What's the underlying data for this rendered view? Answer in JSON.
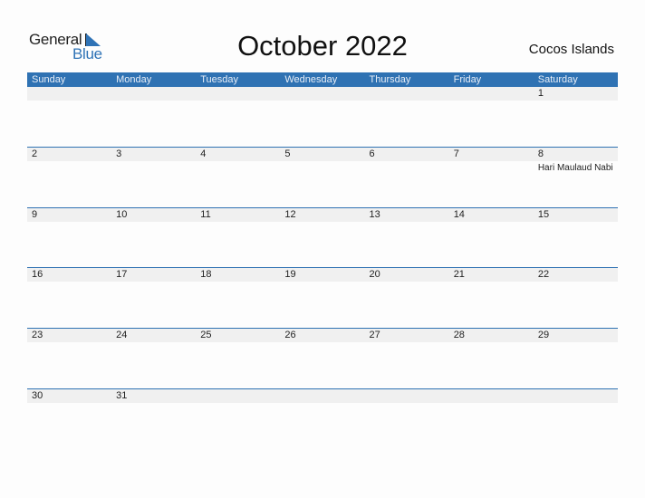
{
  "logo": {
    "line1": "General",
    "line2": "Blue"
  },
  "title": "October 2022",
  "country": "Cocos Islands",
  "colors": {
    "accent": "#2f72b3",
    "band": "#f0f0f0"
  },
  "weekdays": [
    "Sunday",
    "Monday",
    "Tuesday",
    "Wednesday",
    "Thursday",
    "Friday",
    "Saturday"
  ],
  "weeks": [
    [
      {
        "day": ""
      },
      {
        "day": ""
      },
      {
        "day": ""
      },
      {
        "day": ""
      },
      {
        "day": ""
      },
      {
        "day": ""
      },
      {
        "day": "1"
      }
    ],
    [
      {
        "day": "2"
      },
      {
        "day": "3"
      },
      {
        "day": "4"
      },
      {
        "day": "5"
      },
      {
        "day": "6"
      },
      {
        "day": "7"
      },
      {
        "day": "8",
        "event": "Hari Maulaud Nabi"
      }
    ],
    [
      {
        "day": "9"
      },
      {
        "day": "10"
      },
      {
        "day": "11"
      },
      {
        "day": "12"
      },
      {
        "day": "13"
      },
      {
        "day": "14"
      },
      {
        "day": "15"
      }
    ],
    [
      {
        "day": "16"
      },
      {
        "day": "17"
      },
      {
        "day": "18"
      },
      {
        "day": "19"
      },
      {
        "day": "20"
      },
      {
        "day": "21"
      },
      {
        "day": "22"
      }
    ],
    [
      {
        "day": "23"
      },
      {
        "day": "24"
      },
      {
        "day": "25"
      },
      {
        "day": "26"
      },
      {
        "day": "27"
      },
      {
        "day": "28"
      },
      {
        "day": "29"
      }
    ],
    [
      {
        "day": "30"
      },
      {
        "day": "31"
      },
      {
        "day": ""
      },
      {
        "day": ""
      },
      {
        "day": ""
      },
      {
        "day": ""
      },
      {
        "day": ""
      }
    ]
  ]
}
